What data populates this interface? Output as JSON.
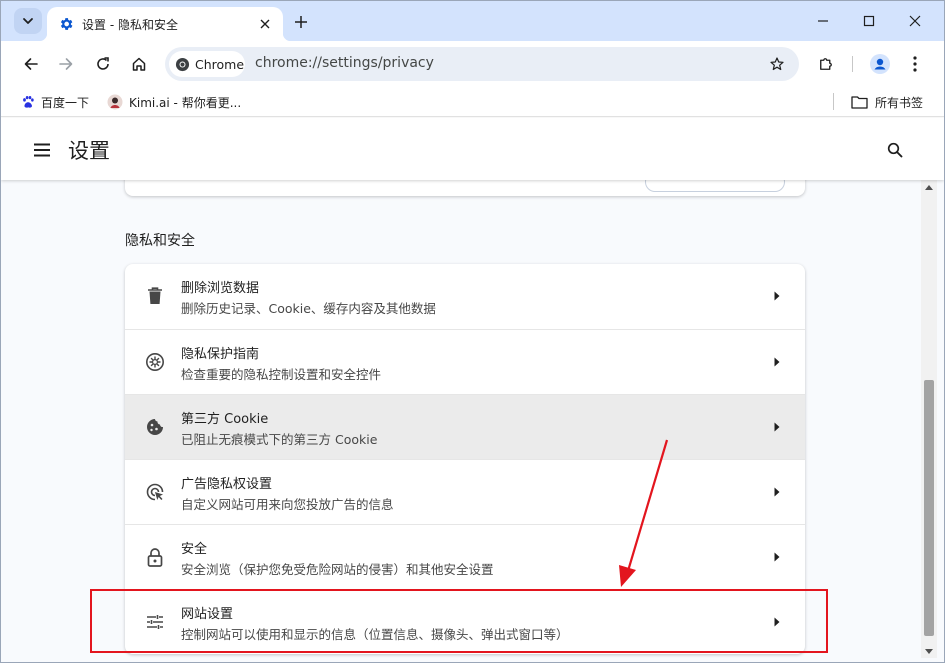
{
  "window": {
    "tab_title": "设置 - 隐私和安全",
    "url": "chrome://settings/privacy",
    "chip_label": "Chrome"
  },
  "bookmarks": [
    {
      "label": "百度一下",
      "icon": "baidu-paw-icon"
    },
    {
      "label": "Kimi.ai - 帮你看更...",
      "icon": "kimi-avatar-icon"
    }
  ],
  "all_bookmarks_label": "所有书签",
  "settings": {
    "title": "设置",
    "section_title": "隐私和安全",
    "items": [
      {
        "title": "删除浏览数据",
        "subtitle": "删除历史记录、Cookie、缓存内容及其他数据",
        "icon": "trash-icon"
      },
      {
        "title": "隐私保护指南",
        "subtitle": "检查重要的隐私控制设置和安全控件",
        "icon": "privacy-guide-icon"
      },
      {
        "title": "第三方 Cookie",
        "subtitle": "已阻止无痕模式下的第三方 Cookie",
        "icon": "cookie-icon",
        "hovered": true
      },
      {
        "title": "广告隐私权设置",
        "subtitle": "自定义网站可用来向您投放广告的信息",
        "icon": "ad-privacy-icon"
      },
      {
        "title": "安全",
        "subtitle": "安全浏览（保护您免受危险网站的侵害）和其他安全设置",
        "icon": "lock-icon"
      },
      {
        "title": "网站设置",
        "subtitle": "控制网站可以使用和显示的信息（位置信息、摄像头、弹出式窗口等）",
        "icon": "tune-icon",
        "highlighted": true
      }
    ]
  },
  "colors": {
    "tabstrip_bg": "#d3e3fd",
    "accent_blue": "#0b57d0",
    "annotation_red": "#e3151e"
  }
}
